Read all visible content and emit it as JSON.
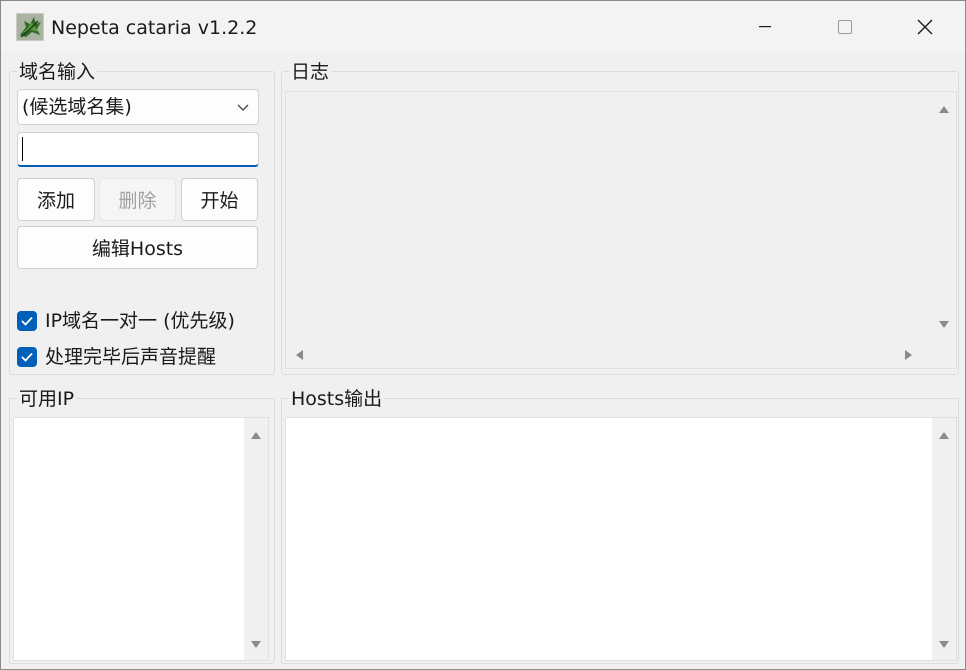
{
  "window": {
    "title": "Nepeta cataria v1.2.2"
  },
  "domain_input": {
    "group_label": "域名输入",
    "combo_value": "(候选域名集)",
    "input_value": "",
    "add_label": "添加",
    "delete_label": "删除",
    "start_label": "开始",
    "edit_hosts_label": "编辑Hosts",
    "checkbox_one_to_one_label": "IP域名一对一 (优先级)",
    "checkbox_one_to_one_checked": true,
    "checkbox_sound_label": "处理完毕后声音提醒",
    "checkbox_sound_checked": true
  },
  "log": {
    "group_label": "日志"
  },
  "available_ip": {
    "group_label": "可用IP"
  },
  "hosts_output": {
    "group_label": "Hosts输出"
  },
  "colors": {
    "accent": "#005fb8",
    "window_bg": "#f0f0f0",
    "list_bg": "#ffffff"
  },
  "icons": {
    "app": "catnip-leaf-icon",
    "minimize": "minimize-icon",
    "maximize": "maximize-icon",
    "close": "close-icon",
    "combo_arrow": "chevron-down-icon",
    "check": "checkmark-icon"
  }
}
